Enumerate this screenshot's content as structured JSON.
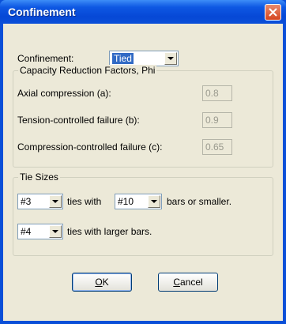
{
  "window": {
    "title": "Confinement"
  },
  "confinement": {
    "label": "Confinement:",
    "selected": "Tied"
  },
  "phi_group": {
    "title": "Capacity Reduction Factors, Phi",
    "rows": [
      {
        "label": "Axial compression (a):",
        "value": "0.8"
      },
      {
        "label": "Tension-controlled failure (b):",
        "value": "0.9"
      },
      {
        "label": "Compression-controlled failure (c):",
        "value": "0.65"
      }
    ]
  },
  "tie_group": {
    "title": "Tie Sizes",
    "row1": {
      "tie_size": "#3",
      "text1": "ties with",
      "bar_size": "#10",
      "text2": "bars or smaller."
    },
    "row2": {
      "tie_size": "#4",
      "text1": "ties with larger bars."
    }
  },
  "buttons": {
    "ok": {
      "mnemonic": "O",
      "rest": "K"
    },
    "cancel": {
      "mnemonic": "C",
      "rest": "ancel"
    }
  }
}
